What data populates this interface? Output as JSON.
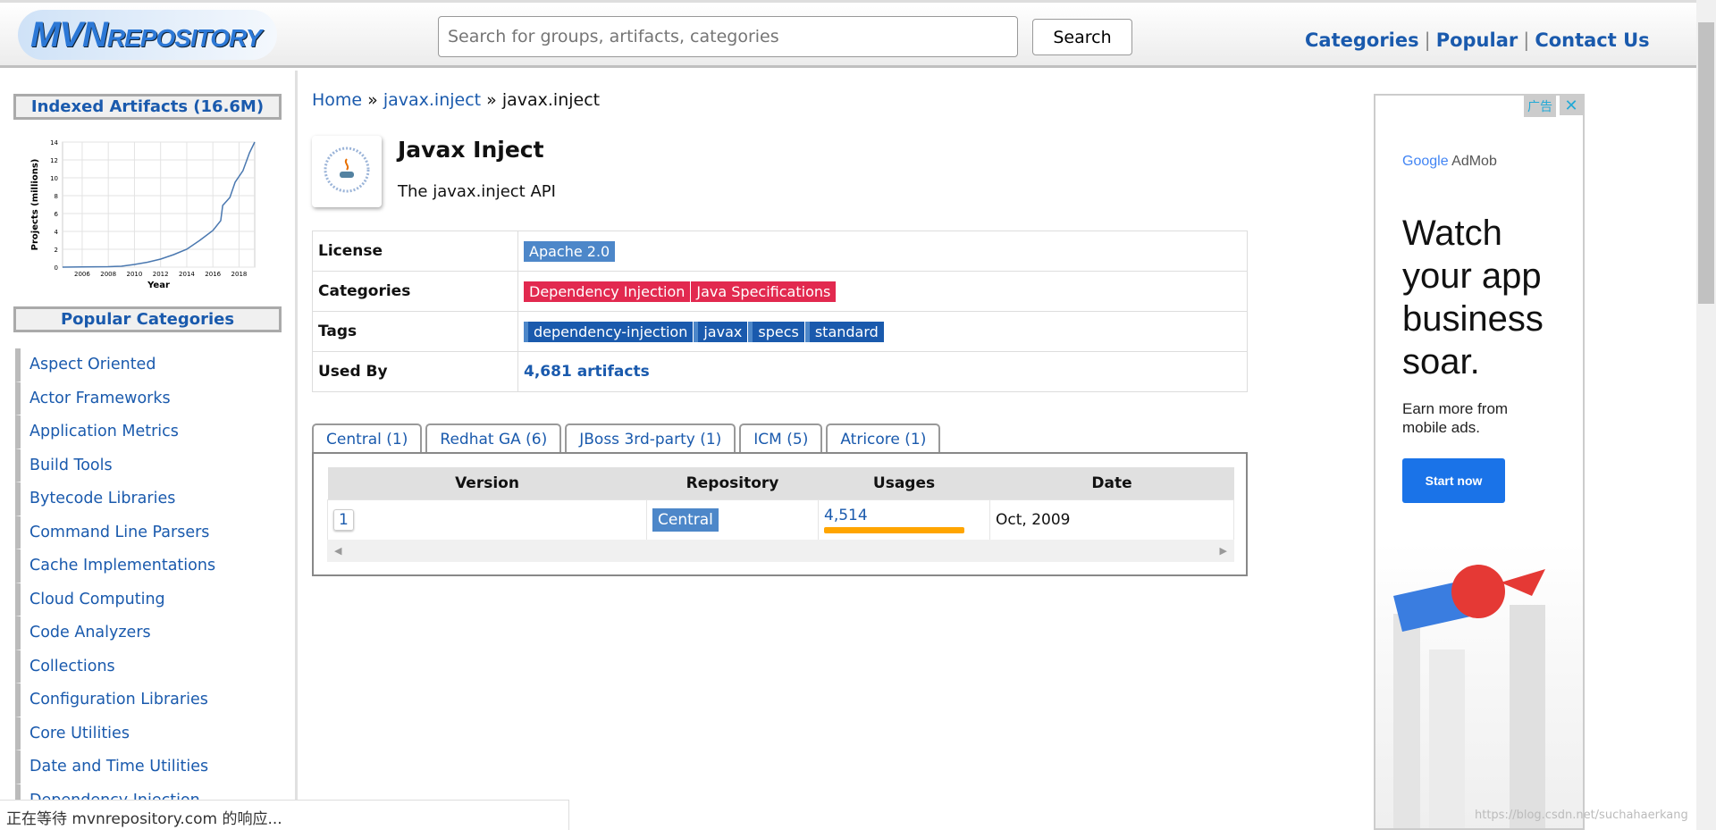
{
  "header": {
    "logo": "MVNREPOSITORY",
    "search_placeholder": "Search for groups, artifacts, categories",
    "search_button": "Search",
    "nav": [
      "Categories",
      "Popular",
      "Contact Us"
    ]
  },
  "sidebar": {
    "indexed_title": "Indexed Artifacts (16.6M)",
    "popular_title": "Popular Categories",
    "categories": [
      "Aspect Oriented",
      "Actor Frameworks",
      "Application Metrics",
      "Build Tools",
      "Bytecode Libraries",
      "Command Line Parsers",
      "Cache Implementations",
      "Cloud Computing",
      "Code Analyzers",
      "Collections",
      "Configuration Libraries",
      "Core Utilities",
      "Date and Time Utilities",
      "Dependency Injection"
    ]
  },
  "chart_data": {
    "type": "line",
    "xlabel": "Year",
    "ylabel": "Projects (millions)",
    "xlim": [
      2004.5,
      2019.2
    ],
    "ylim": [
      0,
      14
    ],
    "xticks": [
      "2006",
      "2008",
      "2010",
      "2012",
      "2014",
      "2016",
      "2018"
    ],
    "yticks": [
      "0",
      "2",
      "4",
      "6",
      "8",
      "10",
      "12",
      "14"
    ],
    "grid": true,
    "x": [
      2004.5,
      2006,
      2008,
      2009,
      2010,
      2011,
      2012,
      2013,
      2014,
      2015,
      2016,
      2016.6,
      2016.75,
      2017.3,
      2017.7,
      2018.3,
      2018.8,
      2019.2
    ],
    "y": [
      0,
      0.02,
      0.05,
      0.1,
      0.3,
      0.55,
      0.9,
      1.4,
      2.0,
      3.0,
      4.1,
      5.2,
      6.9,
      7.8,
      9.5,
      10.8,
      12.8,
      14
    ],
    "color": "#4a78b0"
  },
  "main": {
    "breadcrumb": [
      "Home",
      "javax.inject",
      "javax.inject"
    ],
    "title": "Javax Inject",
    "description": "The javax.inject API",
    "info": {
      "license_label": "License",
      "license": "Apache 2.0",
      "categories_label": "Categories",
      "categories": [
        "Dependency Injection",
        "Java Specifications"
      ],
      "tags_label": "Tags",
      "tags": [
        "dependency-injection",
        "javax",
        "specs",
        "standard"
      ],
      "used_by_label": "Used By",
      "used_by": "4,681 artifacts"
    },
    "tabs": [
      "Central (1)",
      "Redhat GA (6)",
      "JBoss 3rd-party (1)",
      "ICM (5)",
      "Atricore (1)"
    ],
    "versions": {
      "headers": [
        "Version",
        "Repository",
        "Usages",
        "Date"
      ],
      "rows": [
        {
          "version": "1",
          "repository": "Central",
          "usages": "4,514",
          "date": "Oct, 2009"
        }
      ]
    }
  },
  "ad": {
    "label": "广告",
    "close": "✕",
    "brand_google": "Google",
    "brand_product": "AdMob",
    "headline": "Watch your app business soar.",
    "sub": "Earn more from mobile ads.",
    "cta": "Start now"
  },
  "status": "正在等待 mvnrepository.com 的响应...",
  "watermark": "https://blog.csdn.net/suchahaerkang"
}
